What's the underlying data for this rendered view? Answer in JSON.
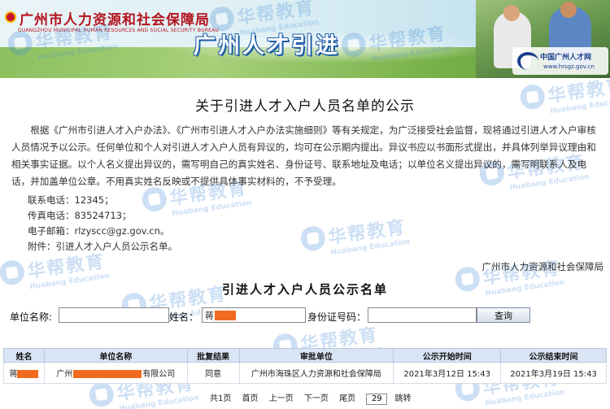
{
  "header": {
    "org_name": "广州市人力资源和社会保障局",
    "org_en": "GUANGZHOU MUNICIPAL HUMAN RESOURCES AND SOCIAL SECURITY BUREAU",
    "banner_title": "广州人才引进",
    "site_badge_name": "中国广州人才网",
    "site_badge_url": "www.hrsgz.gov.cn"
  },
  "watermark": {
    "text": "华帮教育",
    "sub": "Huabang Education"
  },
  "notice": {
    "title": "关于引进人才入户人员名单的公示",
    "body": "根据《广州市引进人才入户办法》、《广州市引进人才入户办法实施细则》等有关规定，为广泛接受社会监督，现将通过引进人才入户审核人员情况予以公示。任何单位和个人对引进人才入户人员有异议的，均可在公示期内提出。异议书应以书面形式提出，并具体列举异议理由和相关事实证据。以个人名义提出异议的，需写明自己的真实姓名、身份证号、联系地址及电话；以单位名义提出异议的，需写明联系人及电话，并加盖单位公章。不用真实姓名反映或不提供具体事实材料的，不予受理。",
    "phone": "联系电话：12345；",
    "fax": "传真电话：83524713；",
    "email": "电子邮箱：rlzyscc@gz.gov.cn。",
    "attachment": "附件：引进人才入户人员公示名单。",
    "signature": "广州市人力资源和社会保障局"
  },
  "list": {
    "title": "引进人才入户人员公示名单",
    "search": {
      "unit_label": "单位名称:",
      "unit_value": "",
      "name_label": "姓名：",
      "name_value": "蒋",
      "id_label": "身份证号码：",
      "id_value": "",
      "button": "查询"
    },
    "columns": [
      "姓名",
      "单位名称",
      "批复结果",
      "审批单位",
      "公示开始时间",
      "公示结束时间"
    ],
    "rows": [
      {
        "name": "蒋",
        "unit_prefix": "广州",
        "unit_suffix": "有限公司",
        "result": "同意",
        "approver": "广州市海珠区人力资源和社会保障局",
        "start": "2021年3月12日 15:43",
        "end": "2021年3月19日 15:43"
      }
    ]
  },
  "pager": {
    "total": "共1页",
    "first": "首页",
    "prev": "上一页",
    "next": "下一页",
    "last": "尾页",
    "page_input": "29",
    "jump": "跳转"
  },
  "colors": {
    "redaction": "#f26a1f",
    "header_red": "#b3121d",
    "table_header_bg": "#d9e4f5"
  }
}
